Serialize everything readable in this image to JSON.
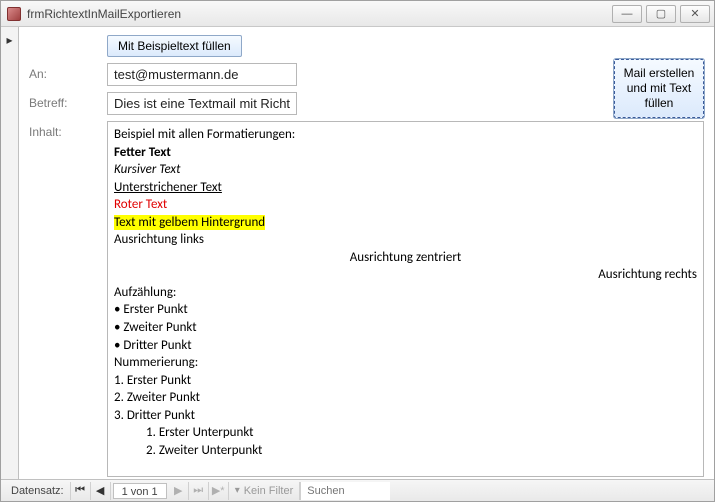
{
  "window": {
    "title": "frmRichtextInMailExportieren"
  },
  "buttons": {
    "fill_example": "Mit Beispieltext füllen",
    "create_mail": "Mail erstellen und mit Text füllen"
  },
  "labels": {
    "to": "An:",
    "subject": "Betreff:",
    "content": "Inhalt:"
  },
  "fields": {
    "to": "test@mustermann.de",
    "subject": "Dies ist eine Textmail mit Richtext-Inhalt."
  },
  "content": {
    "heading": "Beispiel mit allen Formatierungen:",
    "bold": "Fetter Text",
    "italic": "Kursiver Text",
    "underline": "Unterstrichener Text",
    "red": "Roter Text",
    "highlight": "Text mit gelbem Hintergrund",
    "align_left": "Ausrichtung links",
    "align_center": "Ausrichtung zentriert",
    "align_right": "Ausrichtung rechts",
    "bullets_title": "Aufzählung:",
    "bullets": [
      "Erster Punkt",
      "Zweiter Punkt",
      "Dritter Punkt"
    ],
    "numbers_title": "Nummerierung:",
    "numbers": [
      "Erster Punkt",
      "Zweiter Punkt",
      "Dritter Punkt"
    ],
    "sub": [
      "Erster Unterpunkt",
      "Zweiter Unterpunkt"
    ]
  },
  "nav": {
    "label": "Datensatz:",
    "position": "1 von 1",
    "filter": "Kein Filter",
    "search_placeholder": "Suchen"
  }
}
